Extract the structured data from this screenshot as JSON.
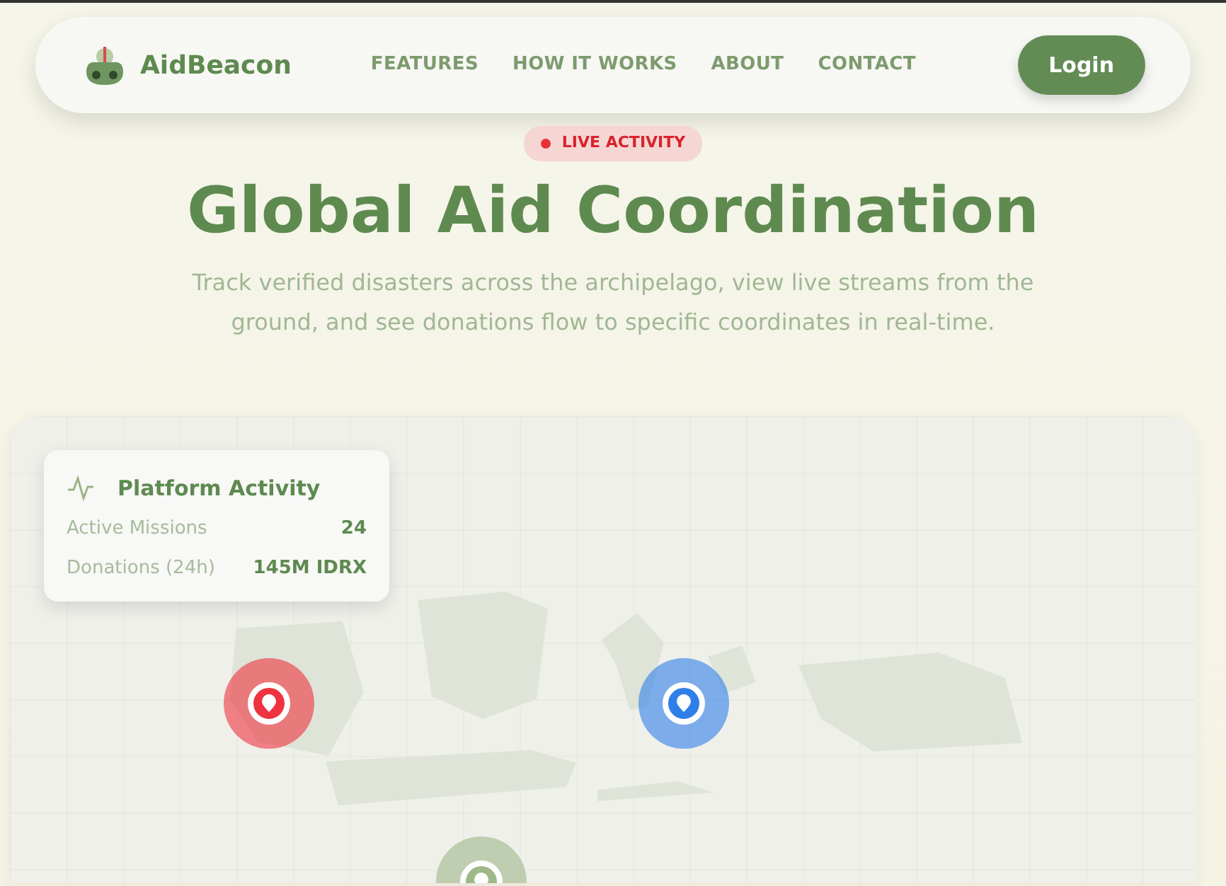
{
  "navbar": {
    "brand": "AidBeacon",
    "links": [
      "FEATURES",
      "HOW IT WORKS",
      "ABOUT",
      "CONTACT"
    ],
    "login": "Login"
  },
  "hero": {
    "badge": "LIVE ACTIVITY",
    "title": "Global Aid Coordination",
    "subtitle": "Track verified disasters across the archipelago, view live streams from the ground, and see donations flow to specific coordinates in real-time."
  },
  "map": {
    "activity_card": {
      "title": "Platform Activity",
      "stats": [
        {
          "label": "Active Missions",
          "value": "24"
        },
        {
          "label": "Donations (24h)",
          "value": "145M IDRX"
        }
      ]
    },
    "markers": [
      {
        "color": "#ef3340"
      },
      {
        "color": "#2f7fe8"
      },
      {
        "color": "#9fb889"
      }
    ]
  }
}
